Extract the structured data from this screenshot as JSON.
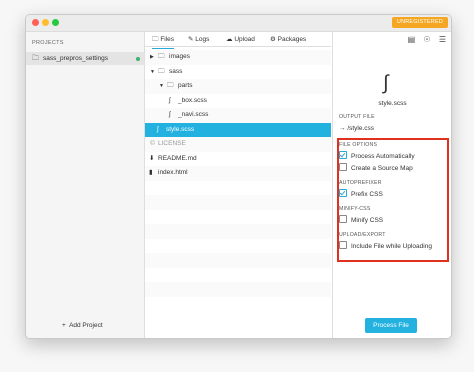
{
  "window": {
    "badge": "UNREGISTERED",
    "traffic_colors": [
      "#fe5f57",
      "#febc2e",
      "#28c840"
    ]
  },
  "sidebar": {
    "heading": "PROJECTS",
    "projects": [
      {
        "name": "sass_prepros_settings",
        "status_color": "#3cb371"
      }
    ],
    "add_label": "Add Project"
  },
  "tabs": [
    {
      "label": "Files",
      "icon": "folder-icon",
      "active": true
    },
    {
      "label": "Logs",
      "icon": "pencil-icon",
      "active": false
    },
    {
      "label": "Upload",
      "icon": "cloud-icon",
      "active": false
    },
    {
      "label": "Packages",
      "icon": "package-icon",
      "active": false
    }
  ],
  "files": [
    {
      "label": "images",
      "type": "folder",
      "depth": 0,
      "expanded": false
    },
    {
      "label": "sass",
      "type": "folder",
      "depth": 0,
      "expanded": true
    },
    {
      "label": "parts",
      "type": "folder",
      "depth": 1,
      "expanded": true
    },
    {
      "label": "_box.scss",
      "type": "sass",
      "depth": 2
    },
    {
      "label": "_navi.scss",
      "type": "sass",
      "depth": 2
    },
    {
      "label": "style.scss",
      "type": "sass",
      "depth": 1,
      "selected": true
    },
    {
      "label": "LICENSE",
      "type": "license",
      "depth": 0,
      "dim": true
    },
    {
      "label": "README.md",
      "type": "markdown",
      "depth": 0
    },
    {
      "label": "index.html",
      "type": "file",
      "depth": 0
    }
  ],
  "detail": {
    "file_name": "style.scss",
    "output_heading": "OUTPUT FILE",
    "output_path": "/style.css",
    "sections": {
      "file_options": "FILE OPTIONS",
      "autoprefixer": "AUTOPREFIXER",
      "minify": "MINIFY-CSS",
      "upload": "UPLOAD/EXPORT"
    },
    "options": {
      "process_auto": {
        "label": "Process Automatically",
        "checked": true
      },
      "source_map": {
        "label": "Create a Source Map",
        "checked": false
      },
      "prefix_css": {
        "label": "Prefix CSS",
        "checked": true
      },
      "minify_css": {
        "label": "Minify CSS",
        "checked": false
      },
      "include_upload": {
        "label": "Include File while Uploading",
        "checked": false
      }
    },
    "process_button": "Process File",
    "highlight_color": "#e0301e"
  }
}
